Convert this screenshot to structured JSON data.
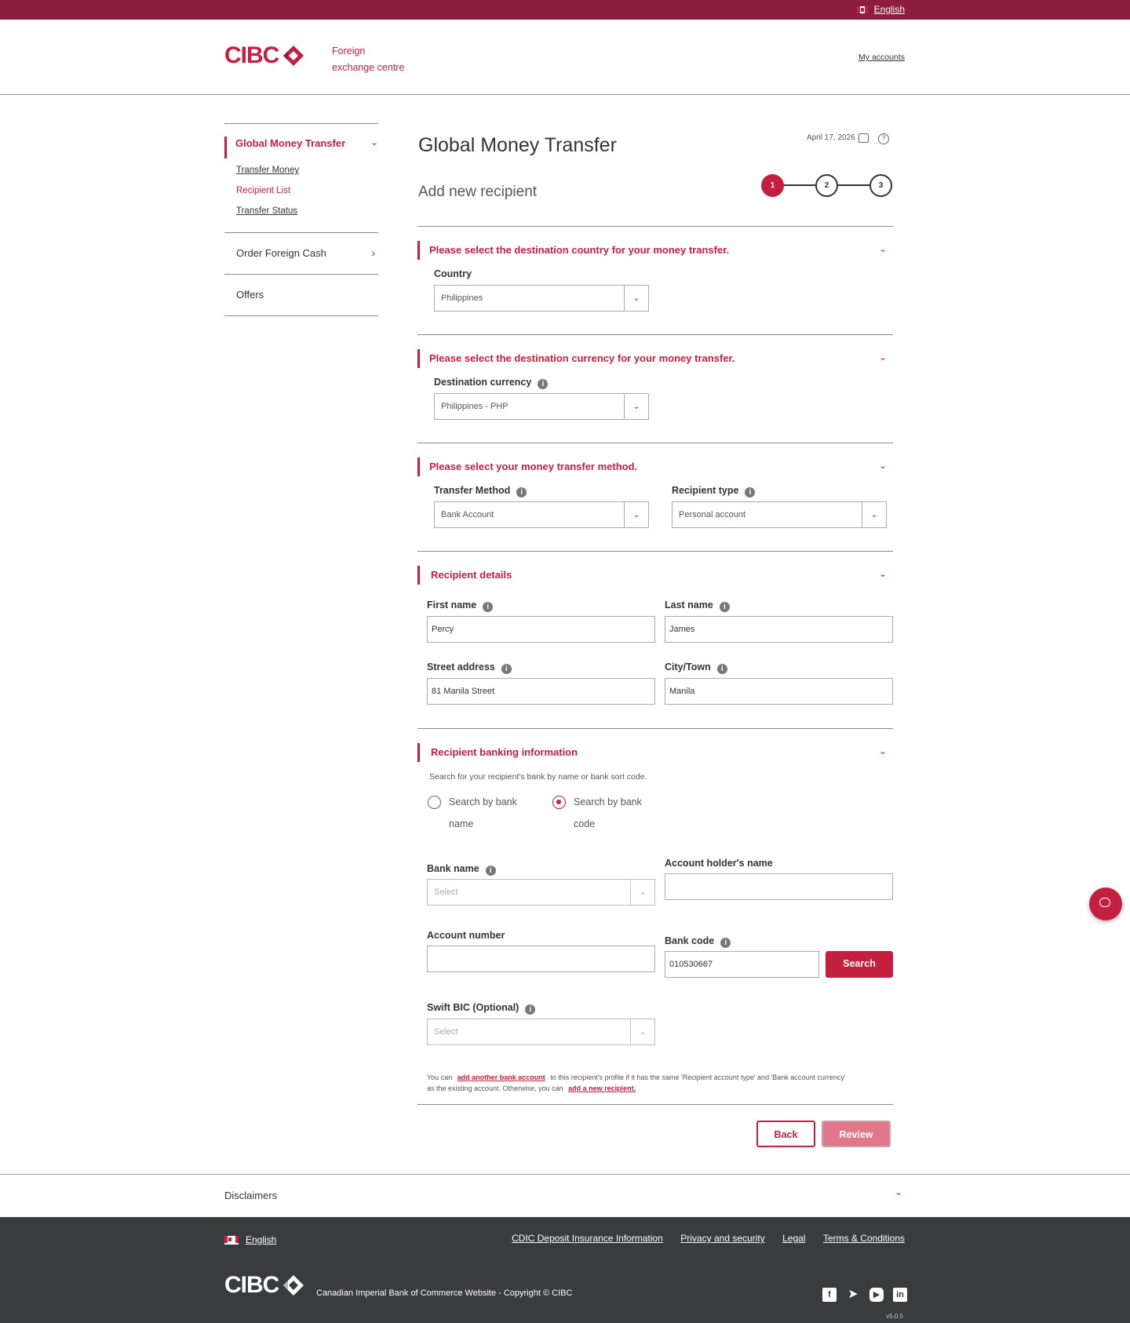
{
  "top_bar": {
    "language": "English"
  },
  "header": {
    "logo": "CIBC",
    "subtitle_line1": "Foreign",
    "subtitle_line2": "exchange centre",
    "my_accounts": "My accounts"
  },
  "sidebar": {
    "gmt_label": "Global Money Transfer",
    "sub_items": [
      "Transfer Money",
      "Recipient List",
      "Transfer Status"
    ],
    "order_cash": "Order Foreign Cash",
    "offers": "Offers"
  },
  "page": {
    "title": "Global Money Transfer",
    "date": "April 17, 2026",
    "subtitle": "Add new recipient",
    "steps": [
      "1",
      "2",
      "3"
    ]
  },
  "sections": {
    "country": {
      "title": "Please select the destination country for your money transfer.",
      "label": "Country",
      "value": "Philippines"
    },
    "currency": {
      "title": "Please select the destination currency for your money transfer.",
      "label": "Destination currency",
      "value": "Philippines - PHP"
    },
    "method": {
      "title": "Please select your money transfer method.",
      "method_label": "Transfer Method",
      "method_value": "Bank Account",
      "type_label": "Recipient type",
      "type_value": "Personal account"
    },
    "details": {
      "title": "Recipient details",
      "first_name_label": "First name",
      "first_name": "Percy",
      "last_name_label": "Last name",
      "last_name": "James",
      "street_label": "Street address",
      "street": "81 Manila Street",
      "city_label": "City/Town",
      "city": "Manila"
    },
    "banking": {
      "title": "Recipient banking information",
      "hint": "Search for your recipient's bank by name or bank sort code.",
      "radio_name_1": "Search by bank",
      "radio_name_2": "name",
      "radio_code_1": "Search by bank",
      "radio_code_2": "code",
      "bank_name_label": "Bank name",
      "bank_name_placeholder": "Select",
      "holder_label": "Account holder's name",
      "holder_value": "",
      "account_label": "Account number",
      "account_value": "",
      "bank_code_label": "Bank code",
      "bank_code_value": "010530667",
      "search_button": "Search",
      "swift_label": "Swift BIC (Optional)",
      "swift_placeholder": "Select",
      "note_1": "You can",
      "note_link1": "add another bank account",
      "note_2": "to this recipient's profile if it has the same 'Recipient account type' and 'Bank account currency'",
      "note_3": "as the existing account. Otherwise, you can",
      "note_link2": "add a new recipient."
    }
  },
  "actions": {
    "back": "Back",
    "review": "Review"
  },
  "disclaimers": "Disclaimers",
  "footer": {
    "language": "English",
    "links": [
      "CDIC Deposit Insurance Information",
      "Privacy and security",
      "Legal",
      "Terms & Conditions"
    ],
    "logo": "CIBC",
    "copyright": "Canadian Imperial Bank of Commerce Website - Copyright © CIBC",
    "version": "v5.0.5"
  },
  "colors": {
    "brand": "#c41f3e",
    "top_bar": "#8b1d40",
    "footer": "#393c3f"
  }
}
